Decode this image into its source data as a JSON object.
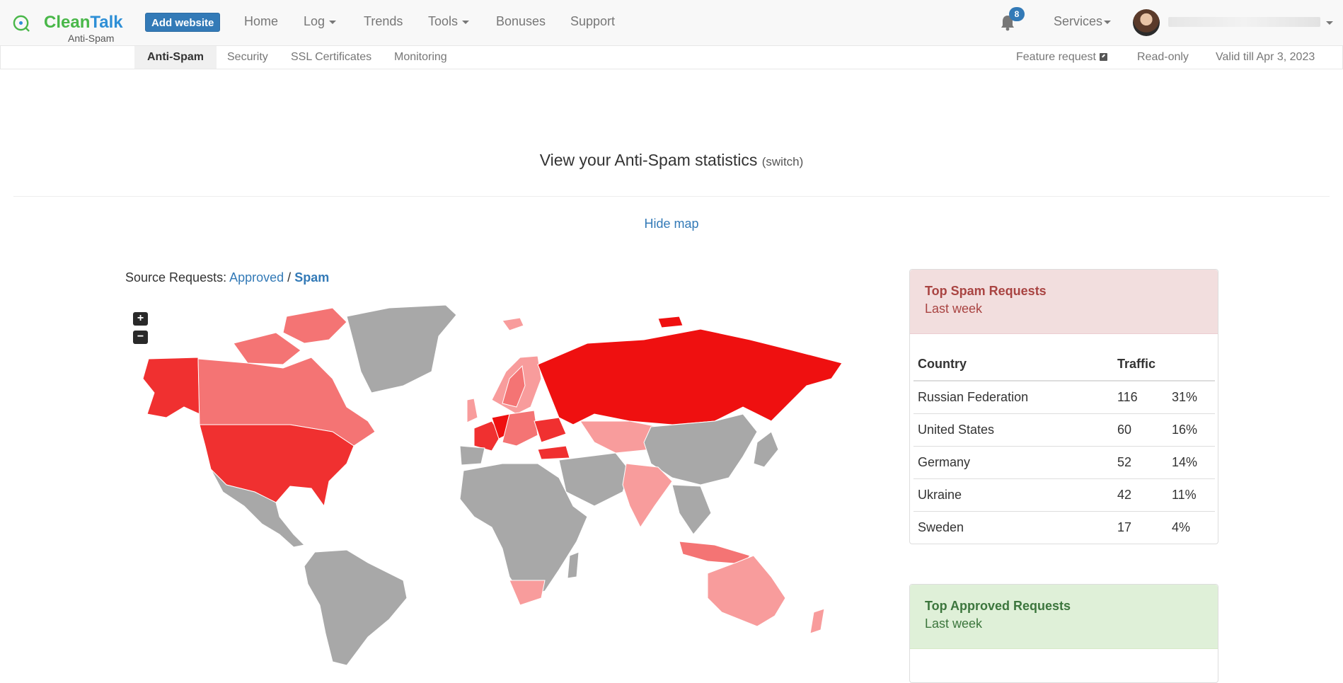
{
  "brand": {
    "name_part1": "Clean",
    "name_part2": "Talk",
    "subtitle": "Anti-Spam"
  },
  "header": {
    "add_website": "Add website",
    "nav": [
      {
        "label": "Home"
      },
      {
        "label": "Log"
      },
      {
        "label": "Trends"
      },
      {
        "label": "Tools"
      },
      {
        "label": "Bonuses"
      },
      {
        "label": "Support"
      }
    ],
    "notifications_count": "8",
    "services": "Services"
  },
  "subnav": {
    "tabs": [
      {
        "label": "Anti-Spam"
      },
      {
        "label": "Security"
      },
      {
        "label": "SSL Certificates"
      },
      {
        "label": "Monitoring"
      }
    ],
    "feature_request": "Feature request",
    "read_only": "Read-only",
    "valid_till": "Valid till Apr 3, 2023"
  },
  "main": {
    "heading": "View your Anti-Spam statistics",
    "switch": "(switch)",
    "hide_map": "Hide map",
    "source_label": "Source Requests:",
    "approved": "Approved",
    "separator": "/",
    "spam": "Spam"
  },
  "map": {
    "zoom_in": "+",
    "zoom_out": "−",
    "spam_colors": [
      "#ef1010",
      "#f03030",
      "#f47474",
      "#f89c9c",
      "#a8a8a8"
    ]
  },
  "spam_panel": {
    "title": "Top Spam Requests",
    "period": "Last week",
    "columns": [
      "Country",
      "Traffic"
    ],
    "rows": [
      {
        "country": "Russian Federation",
        "count": "116",
        "pct": "31%"
      },
      {
        "country": "United States",
        "count": "60",
        "pct": "16%"
      },
      {
        "country": "Germany",
        "count": "52",
        "pct": "14%"
      },
      {
        "country": "Ukraine",
        "count": "42",
        "pct": "11%"
      },
      {
        "country": "Sweden",
        "count": "17",
        "pct": "4%"
      }
    ]
  },
  "approved_panel": {
    "title": "Top Approved Requests",
    "period": "Last week"
  }
}
